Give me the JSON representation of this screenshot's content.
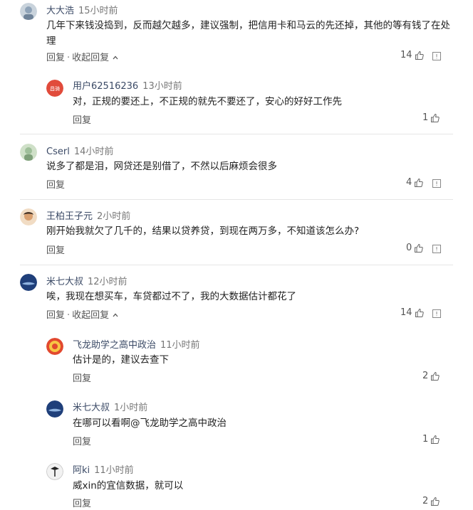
{
  "comments": [
    {
      "name": "大大浩",
      "time": "15小时前",
      "text_lines": [
        "几年下来钱没捣到，反而越欠越多，建议强制，把信用卡和马云的先还掉，其他的等有钱了在处",
        "理"
      ],
      "reply_label": "回复",
      "sep": "·",
      "collapse_label": "收起回复",
      "likes": "14",
      "avatar_color": "#8fa3b8"
    },
    {
      "name": "用户62516236",
      "time": "13小时前",
      "text_lines": [
        "对，正规的要还上，不正规的就先不要还了，安心的好好工作先"
      ],
      "reply_label": "回复",
      "likes": "1",
      "avatar_color": "#e14b3b",
      "avatar_text": "昌骑"
    },
    {
      "name": "Cserl",
      "time": "14小时前",
      "text_lines": [
        "说多了都是泪，网贷还是别借了，不然以后麻烦会很多"
      ],
      "reply_label": "回复",
      "likes": "4",
      "avatar_color": "#9fbf9a"
    },
    {
      "name": "王柏王子元",
      "time": "2小时前",
      "text_lines": [
        "刚开始我就欠了几千的，结果以贷养贷，到现在两万多，不知道该怎么办?"
      ],
      "reply_label": "回复",
      "likes": "0",
      "avatar_color": "#d9a070"
    },
    {
      "name": "米七大叔",
      "time": "12小时前",
      "text_lines": [
        "唉，我现在想买车，车贷都过不了，我的大数据估计都花了"
      ],
      "reply_label": "回复",
      "sep": "·",
      "collapse_label": "收起回复",
      "likes": "14",
      "avatar_color": "#1f3f7a"
    },
    {
      "name": "飞龙助学之高中政治",
      "time": "11小时前",
      "text_lines": [
        "估计是的，建议去查下"
      ],
      "reply_label": "回复",
      "likes": "2",
      "avatar_color": "#e2492f"
    },
    {
      "name": "米七大叔",
      "time": "1小时前",
      "text_lines": [
        "在哪可以看啊@飞龙助学之高中政治"
      ],
      "reply_label": "回复",
      "likes": "1",
      "avatar_color": "#1f3f7a"
    },
    {
      "name": "阿ki",
      "time": "11小时前",
      "text_lines": [
        "威xin的宜信数据，就可以"
      ],
      "reply_label": "回复",
      "likes": "2",
      "avatar_color": "#f2f2f2"
    }
  ]
}
